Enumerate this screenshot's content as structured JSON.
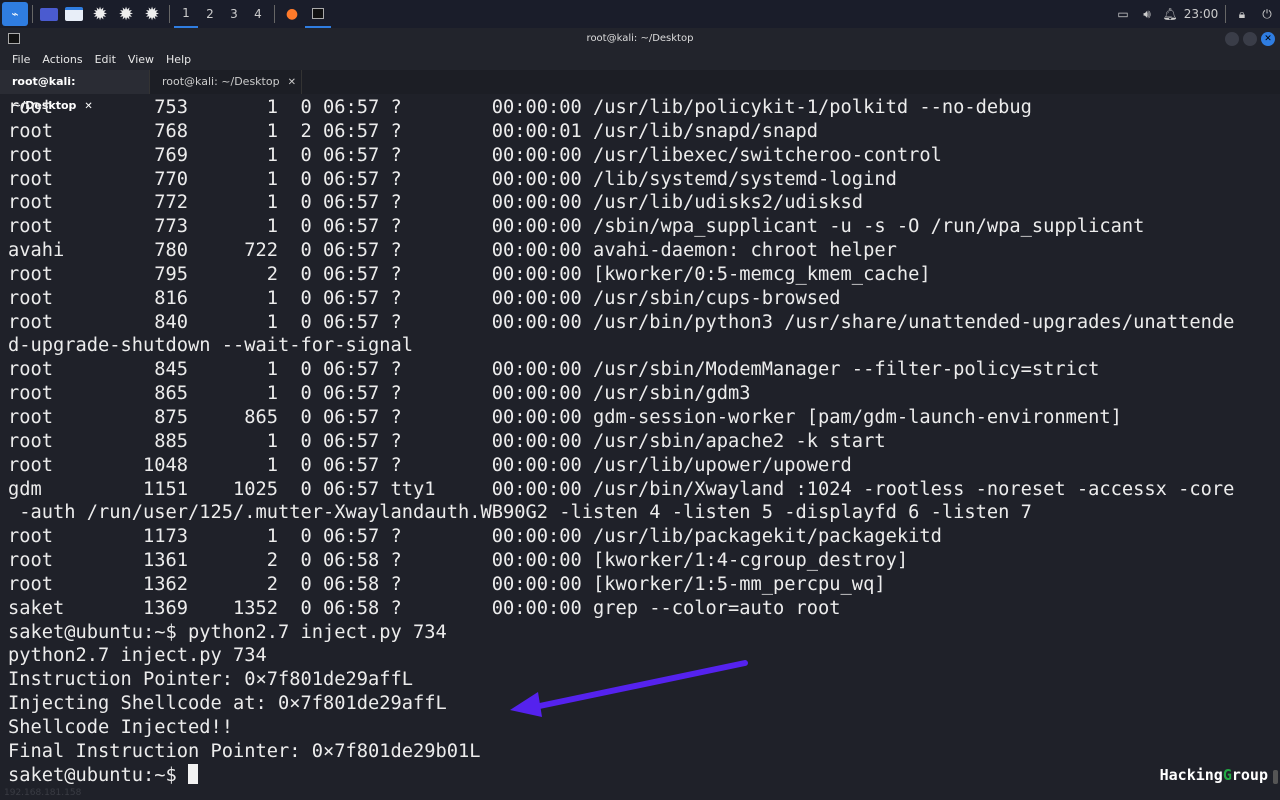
{
  "taskbar": {
    "workspaces": [
      "1",
      "2",
      "3",
      "4"
    ],
    "clock": "23:00"
  },
  "window": {
    "title": "root@kali: ~/Desktop",
    "menu": [
      "File",
      "Actions",
      "Edit",
      "View",
      "Help"
    ],
    "tabs": [
      {
        "label": "root@kali: ~/Desktop",
        "active": true
      },
      {
        "label": "root@kali: ~/Desktop",
        "active": false
      }
    ]
  },
  "terminal": {
    "lines": [
      "root         753       1  0 06:57 ?        00:00:00 /usr/lib/policykit-1/polkitd --no-debug",
      "root         768       1  2 06:57 ?        00:00:01 /usr/lib/snapd/snapd",
      "root         769       1  0 06:57 ?        00:00:00 /usr/libexec/switcheroo-control",
      "root         770       1  0 06:57 ?        00:00:00 /lib/systemd/systemd-logind",
      "root         772       1  0 06:57 ?        00:00:00 /usr/lib/udisks2/udisksd",
      "root         773       1  0 06:57 ?        00:00:00 /sbin/wpa_supplicant -u -s -O /run/wpa_supplicant",
      "avahi        780     722  0 06:57 ?        00:00:00 avahi-daemon: chroot helper",
      "root         795       2  0 06:57 ?        00:00:00 [kworker/0:5-memcg_kmem_cache]",
      "root         816       1  0 06:57 ?        00:00:00 /usr/sbin/cups-browsed",
      "root         840       1  0 06:57 ?        00:00:00 /usr/bin/python3 /usr/share/unattended-upgrades/unattende",
      "d-upgrade-shutdown --wait-for-signal",
      "root         845       1  0 06:57 ?        00:00:00 /usr/sbin/ModemManager --filter-policy=strict",
      "root         865       1  0 06:57 ?        00:00:00 /usr/sbin/gdm3",
      "root         875     865  0 06:57 ?        00:00:00 gdm-session-worker [pam/gdm-launch-environment]",
      "root         885       1  0 06:57 ?        00:00:00 /usr/sbin/apache2 -k start",
      "root        1048       1  0 06:57 ?        00:00:00 /usr/lib/upower/upowerd",
      "gdm         1151    1025  0 06:57 tty1     00:00:00 /usr/bin/Xwayland :1024 -rootless -noreset -accessx -core",
      " -auth /run/user/125/.mutter-Xwaylandauth.WB90G2 -listen 4 -listen 5 -displayfd 6 -listen 7",
      "root        1173       1  0 06:57 ?        00:00:00 /usr/lib/packagekit/packagekitd",
      "root        1361       2  0 06:58 ?        00:00:00 [kworker/1:4-cgroup_destroy]",
      "root        1362       2  0 06:58 ?        00:00:00 [kworker/1:5-mm_percpu_wq]",
      "saket       1369    1352  0 06:58 ?        00:00:00 grep --color=auto root",
      "saket@ubuntu:~$ python2.7 inject.py 734",
      "python2.7 inject.py 734",
      "Instruction Pointer: 0×7f801de29affL",
      "Injecting Shellcode at: 0×7f801de29affL",
      "Shellcode Injected!!",
      "Final Instruction Pointer: 0×7f801de29b01L"
    ],
    "prompt": "saket@ubuntu:~$ "
  },
  "watermark": {
    "text_a": "Hacking",
    "text_b": "G",
    "text_c": "roup"
  },
  "footer_ip": "192.168.181.158",
  "colors": {
    "arrow": "#5522ee",
    "accent": "#2f7de1"
  }
}
